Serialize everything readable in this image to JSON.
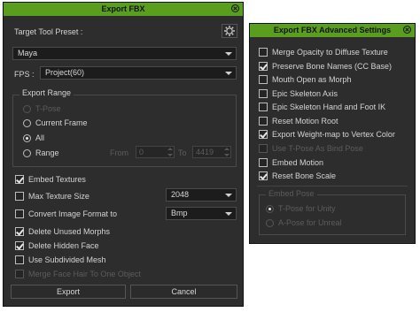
{
  "export_fbx": {
    "title": "Export FBX",
    "target_tool_preset_label": "Target Tool Preset :",
    "preset_value": "Maya",
    "fps_label": "FPS :",
    "fps_value": "Project(60)",
    "export_range": {
      "title": "Export Range",
      "options": [
        {
          "label": "T-Pose",
          "selected": false,
          "enabled": false
        },
        {
          "label": "Current Frame",
          "selected": false,
          "enabled": true
        },
        {
          "label": "All",
          "selected": true,
          "enabled": true
        },
        {
          "label": "Range",
          "selected": false,
          "enabled": true
        }
      ],
      "from_label": "From",
      "from_value": "0",
      "to_label": "To",
      "to_value": "4419"
    },
    "options": [
      {
        "label": "Embed Textures",
        "checked": true,
        "enabled": true
      },
      {
        "label": "Max Texture Size",
        "checked": false,
        "enabled": true,
        "dropdown": "2048"
      },
      {
        "label": "Convert Image Format to",
        "checked": false,
        "enabled": true,
        "dropdown": "Bmp"
      },
      {
        "label": "Delete Unused Morphs",
        "checked": true,
        "enabled": true
      },
      {
        "label": "Delete Hidden Face",
        "checked": true,
        "enabled": true
      },
      {
        "label": "Use Subdivided Mesh",
        "checked": false,
        "enabled": true
      },
      {
        "label": "Merge Face Hair To One Object",
        "checked": false,
        "enabled": false
      }
    ],
    "export_button": "Export",
    "cancel_button": "Cancel"
  },
  "advanced": {
    "title": "Export FBX Advanced Settings",
    "items": [
      {
        "label": "Merge Opacity to Diffuse Texture",
        "checked": false,
        "enabled": true
      },
      {
        "label": "Preserve Bone Names (CC Base)",
        "checked": true,
        "enabled": true
      },
      {
        "label": "Mouth Open as Morph",
        "checked": false,
        "enabled": true
      },
      {
        "label": "Epic Skeleton Axis",
        "checked": false,
        "enabled": true
      },
      {
        "label": "Epic Skeleton Hand and Foot IK",
        "checked": false,
        "enabled": true
      },
      {
        "label": "Reset Motion Root",
        "checked": false,
        "enabled": true
      },
      {
        "label": "Export Weight-map to Vertex Color",
        "checked": true,
        "enabled": true
      },
      {
        "label": "Use T-Pose As Bind Pose",
        "checked": false,
        "enabled": false
      },
      {
        "label": "Embed Motion",
        "checked": false,
        "enabled": true
      },
      {
        "label": "Reset Bone Scale",
        "checked": true,
        "enabled": true
      }
    ],
    "embed_pose": {
      "title": "Embed Pose",
      "options": [
        {
          "label": "T-Pose for Unity",
          "selected": true,
          "enabled": false
        },
        {
          "label": "A-Pose for Unreal",
          "selected": false,
          "enabled": false
        }
      ]
    }
  },
  "colors": {
    "title_bar": "#5a9e1e",
    "panel_bg": "#2d2d2d",
    "field_bg": "#1c1c1c",
    "text": "#d4d4d4",
    "disabled_text": "#5c5c5c"
  }
}
